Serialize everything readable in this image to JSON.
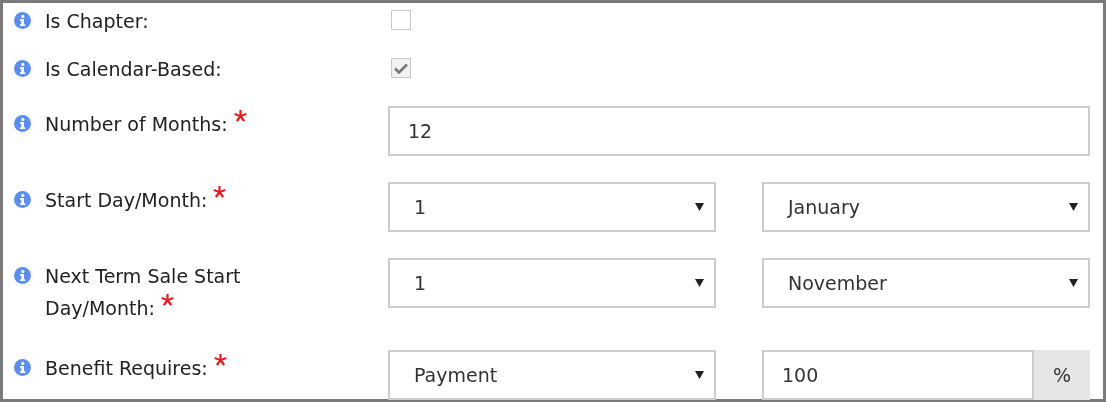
{
  "rows": [
    {
      "kind": "checkbox",
      "label": "Is Chapter:",
      "required": false,
      "checked": false
    },
    {
      "kind": "checkbox",
      "label": "Is Calendar-Based:",
      "required": false,
      "checked": true
    },
    {
      "kind": "text",
      "label": "Number of Months:",
      "required": true,
      "value": "12"
    },
    {
      "kind": "select-pair",
      "label": "Start Day/Month:",
      "required": true,
      "selects": [
        {
          "value": "1"
        },
        {
          "value": "January"
        }
      ]
    },
    {
      "kind": "select-pair",
      "label": "Next Term Sale Start Day/Month:",
      "required": true,
      "selects": [
        {
          "value": "1"
        },
        {
          "value": "November"
        }
      ]
    },
    {
      "kind": "select-addon",
      "label": "Benefit Requires:",
      "required": true,
      "select": {
        "value": "Payment"
      },
      "input": {
        "value": "100"
      },
      "addon": "%"
    }
  ]
}
